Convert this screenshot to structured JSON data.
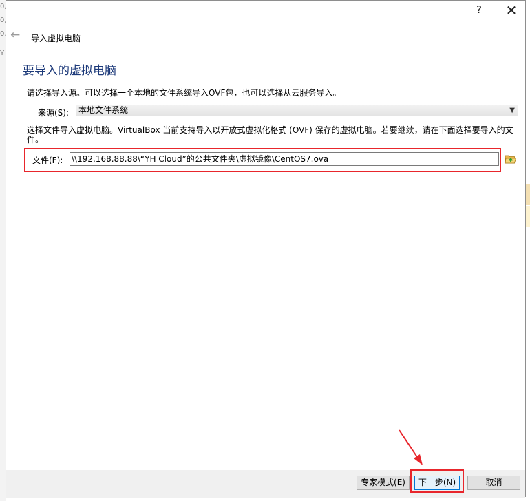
{
  "background": {
    "left_fragments": [
      "0,",
      "0,",
      "0,",
      "Y"
    ]
  },
  "titlebar": {
    "help_glyph": "?",
    "close_glyph": "✕"
  },
  "nav": {
    "back_glyph": "←",
    "title": "导入虚拟电脑"
  },
  "page": {
    "heading": "要导入的虚拟电脑",
    "intro": "请选择导入源。可以选择一个本地的文件系统导入OVF包，也可以选择从云服务导入。",
    "source": {
      "label": "来源(S):",
      "selected": "本地文件系统"
    },
    "description": "选择文件导入虚拟电脑。VirtualBox 当前支持导入以开放式虚拟化格式 (OVF) 保存的虚拟电脑。若要继续，请在下面选择要导入的文件。",
    "file": {
      "label": "文件(F):",
      "value": "\\\\192.168.88.88\\“YH Cloud”的公共文件夹\\虚拟镜像\\CentOS7.ova"
    }
  },
  "footer": {
    "expert_label": "专家模式(E)",
    "next_label": "下一步(N)",
    "cancel_label": "取消"
  },
  "icons": {
    "folder": "folder-open-icon",
    "select_arrow": "chevron-down-icon"
  },
  "colors": {
    "heading": "#1d3a7a",
    "annotation": "#e8262c",
    "default_button_border": "#0078d7"
  }
}
